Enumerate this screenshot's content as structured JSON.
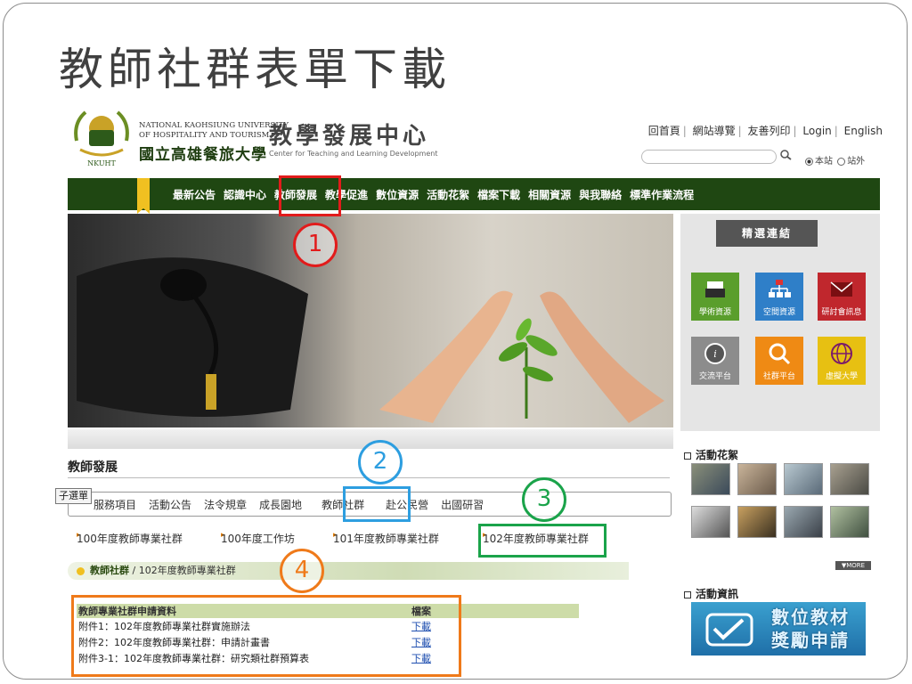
{
  "slide": {
    "title": "教師社群表單下載"
  },
  "site": {
    "logo": {
      "emblem_text": "NKUHT",
      "university_en": "NATIONAL KAOHSIUNG UNIVERSITY\nOF HOSPITALITY AND TOURISM",
      "university_zh": "國立高雄餐旅大學",
      "center_zh": "教學發展中心",
      "center_en": "Center for Teaching and Learning Development"
    },
    "toplinks": [
      "回首頁",
      "網站導覽",
      "友善列印",
      "Login",
      "English"
    ],
    "search": {
      "placeholder": "",
      "scope_options": [
        "本站",
        "站外"
      ],
      "scope_selected": "本站"
    },
    "nav": [
      "最新公告",
      "認識中心",
      "教師發展",
      "教學促進",
      "數位資源",
      "活動花絮",
      "檔案下載",
      "相關資源",
      "與我聯絡",
      "標準作業流程"
    ],
    "featured": {
      "title": "精選連結",
      "tiles": [
        {
          "label": "學術資源",
          "color": "#5a9e2c",
          "icon": "printer-icon"
        },
        {
          "label": "空間資源",
          "color": "#2f7fc8",
          "icon": "org-chart-icon"
        },
        {
          "label": "研討會訊息",
          "color": "#c0272d",
          "icon": "envelope-icon"
        },
        {
          "label": "交流平台",
          "color": "#8c8c8c",
          "icon": "ta-info-icon",
          "sub": "TA"
        },
        {
          "label": "社群平台",
          "color": "#ef8a14",
          "icon": "magnifier-icon",
          "sub": "教師"
        },
        {
          "label": "虛擬大學",
          "color": "#e7c012",
          "icon": "globe-icon"
        }
      ]
    },
    "section": {
      "title": "教師發展",
      "submenu_tag": "子選單",
      "submenu": [
        "服務項目",
        "活動公告",
        "法令規章",
        "成長園地",
        "教師社群",
        "赴公民營",
        "出國研習"
      ],
      "years": [
        "100年度教師專業社群",
        "100年度工作坊",
        "101年度教師專業社群",
        "102年度教師專業社群"
      ],
      "crumb_main": "教師社群",
      "crumb_sub": "102年度教師專業社群",
      "table": {
        "headers": [
          "教師專業社群申請資料",
          "檔案"
        ],
        "rows": [
          {
            "name": "附件1：102年度教師專業社群實施辦法",
            "link": "下載"
          },
          {
            "name": "附件2：102年度教師專業社群：申請計畫書",
            "link": "下載"
          },
          {
            "name": "附件3-1：102年度教師專業社群：研究類社群預算表",
            "link": "下載"
          }
        ]
      }
    },
    "activities": {
      "title": "活動花絮",
      "more": "▼MORE"
    },
    "info": {
      "title": "活動資訊",
      "promo_line1": "數位教材",
      "promo_line2": "獎勵申請"
    }
  },
  "annotations": {
    "step1": {
      "num": "1",
      "color": "#e21b1b"
    },
    "step2": {
      "num": "2",
      "color": "#2d9ee0"
    },
    "step3": {
      "num": "3",
      "color": "#1aa34a"
    },
    "step4": {
      "num": "4",
      "color": "#ef7a1a"
    }
  }
}
